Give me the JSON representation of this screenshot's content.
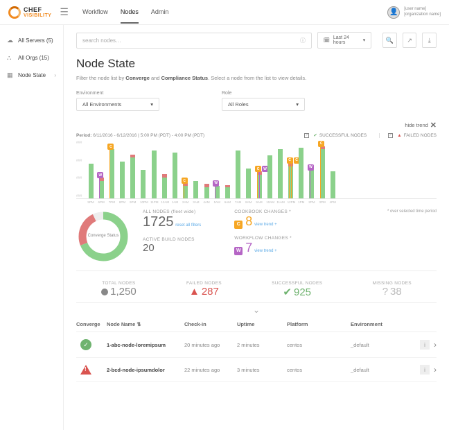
{
  "brand": {
    "l1": "CHEF",
    "l2": "VISIBILITY"
  },
  "nav": {
    "workflow": "Workflow",
    "nodes": "Nodes",
    "admin": "Admin"
  },
  "user": {
    "name": "[user name]",
    "org": "[organization name]"
  },
  "sidebar": {
    "servers": "All Servers (5)",
    "orgs": "All Orgs (15)",
    "nodestate": "Node State"
  },
  "search": {
    "placeholder": "search nodes…"
  },
  "range": "Last 24 hours",
  "page": {
    "title": "Node State",
    "subtitle_pre": "Filter the node list by ",
    "subtitle_b1": "Converge",
    "subtitle_mid": " and ",
    "subtitle_b2": "Compliance Status",
    "subtitle_post": ". Select a node from the list to view details."
  },
  "filters": {
    "env_label": "Environment",
    "env_value": "All Environments",
    "role_label": "Role",
    "role_value": "All Roles"
  },
  "hide_trend": "hide trend",
  "trend": {
    "period_label": "Period:",
    "period": "6/11/2016 - 6/12/2016  |  5:00 PM (PDT) - 4:00 PM (PDT)",
    "success": "SUCCESSFUL NODES",
    "failed": "FAILED NODES"
  },
  "chart_data": {
    "type": "bar",
    "ylabels": [
      "###",
      "###",
      "###",
      "###"
    ],
    "x": [
      "5PM",
      "6PM",
      "7PM",
      "8PM",
      "9PM",
      "10PM",
      "11PM",
      "12AM",
      "1AM",
      "2AM",
      "3AM",
      "4AM",
      "5AM",
      "6AM",
      "7AM",
      "8AM",
      "9AM",
      "10AM",
      "11AM",
      "12PM",
      "1PM",
      "2PM",
      "3PM",
      "4PM"
    ],
    "series": [
      {
        "name": "SUCCESSFUL NODES",
        "color": "#8bd18b",
        "values": [
          44,
          22,
          62,
          46,
          52,
          36,
          60,
          26,
          58,
          16,
          22,
          14,
          16,
          14,
          60,
          38,
          30,
          54,
          62,
          40,
          64,
          36,
          62,
          34
        ]
      },
      {
        "name": "FAILED NODES",
        "color": "#e07a7a",
        "values": [
          0,
          4,
          0,
          0,
          3,
          0,
          0,
          5,
          0,
          3,
          0,
          4,
          0,
          3,
          0,
          0,
          4,
          0,
          0,
          5,
          0,
          0,
          4,
          0
        ]
      }
    ],
    "markers": [
      {
        "type": "W",
        "index": 1,
        "color": "#b565c5"
      },
      {
        "type": "C",
        "index": 2,
        "color": "#f6a623"
      },
      {
        "type": "C",
        "index": 9,
        "color": "#f6a623"
      },
      {
        "type": "W",
        "index": 12,
        "color": "#b565c5"
      },
      {
        "type": "C",
        "index": 16,
        "color": "#f6a623"
      },
      {
        "type": "W",
        "index": 16,
        "color": "#b565c5"
      },
      {
        "type": "C",
        "index": 19,
        "color": "#f6a623"
      },
      {
        "type": "C",
        "index": 19,
        "color": "#f6a623"
      },
      {
        "type": "W",
        "index": 21,
        "color": "#b565c5"
      },
      {
        "type": "C",
        "index": 22,
        "color": "#f6a623"
      }
    ]
  },
  "stats": {
    "donut": "Converge Status",
    "all_nodes_lbl": "ALL NODES (fleet wide)",
    "all_nodes": "1725",
    "reset": "reset all filters",
    "active_lbl": "ACTIVE BUILD NODES",
    "active": "20",
    "cookbook_lbl": "COOKBOOK CHANGES *",
    "cookbook": "8",
    "view_trend": "view trend +",
    "workflow_lbl": "WORKFLOW CHANGES *",
    "workflow": "7",
    "overnote": "* over selected time period"
  },
  "tally": {
    "total_lbl": "TOTAL NODES",
    "total": "1,250",
    "failed_lbl": "FAILED NODES",
    "failed": "287",
    "success_lbl": "SUCCESSFUL NODES",
    "success": "925",
    "missing_lbl": "MISSING NODES",
    "missing": "38"
  },
  "table": {
    "h_conv": "Converge",
    "h_name": "Node Name",
    "h_checkin": "Check-in",
    "h_uptime": "Uptime",
    "h_platform": "Platform",
    "h_env": "Environment",
    "rows": [
      {
        "status": "ok",
        "name": "1-abc-node-loremipsum",
        "checkin": "20 minutes ago",
        "uptime": "2 minutes",
        "platform": "centos",
        "env": "_default"
      },
      {
        "status": "warn",
        "name": "2-bcd-node-ipsumdolor",
        "checkin": "22 minutes ago",
        "uptime": "3 minutes",
        "platform": "centos",
        "env": "_default"
      }
    ]
  }
}
